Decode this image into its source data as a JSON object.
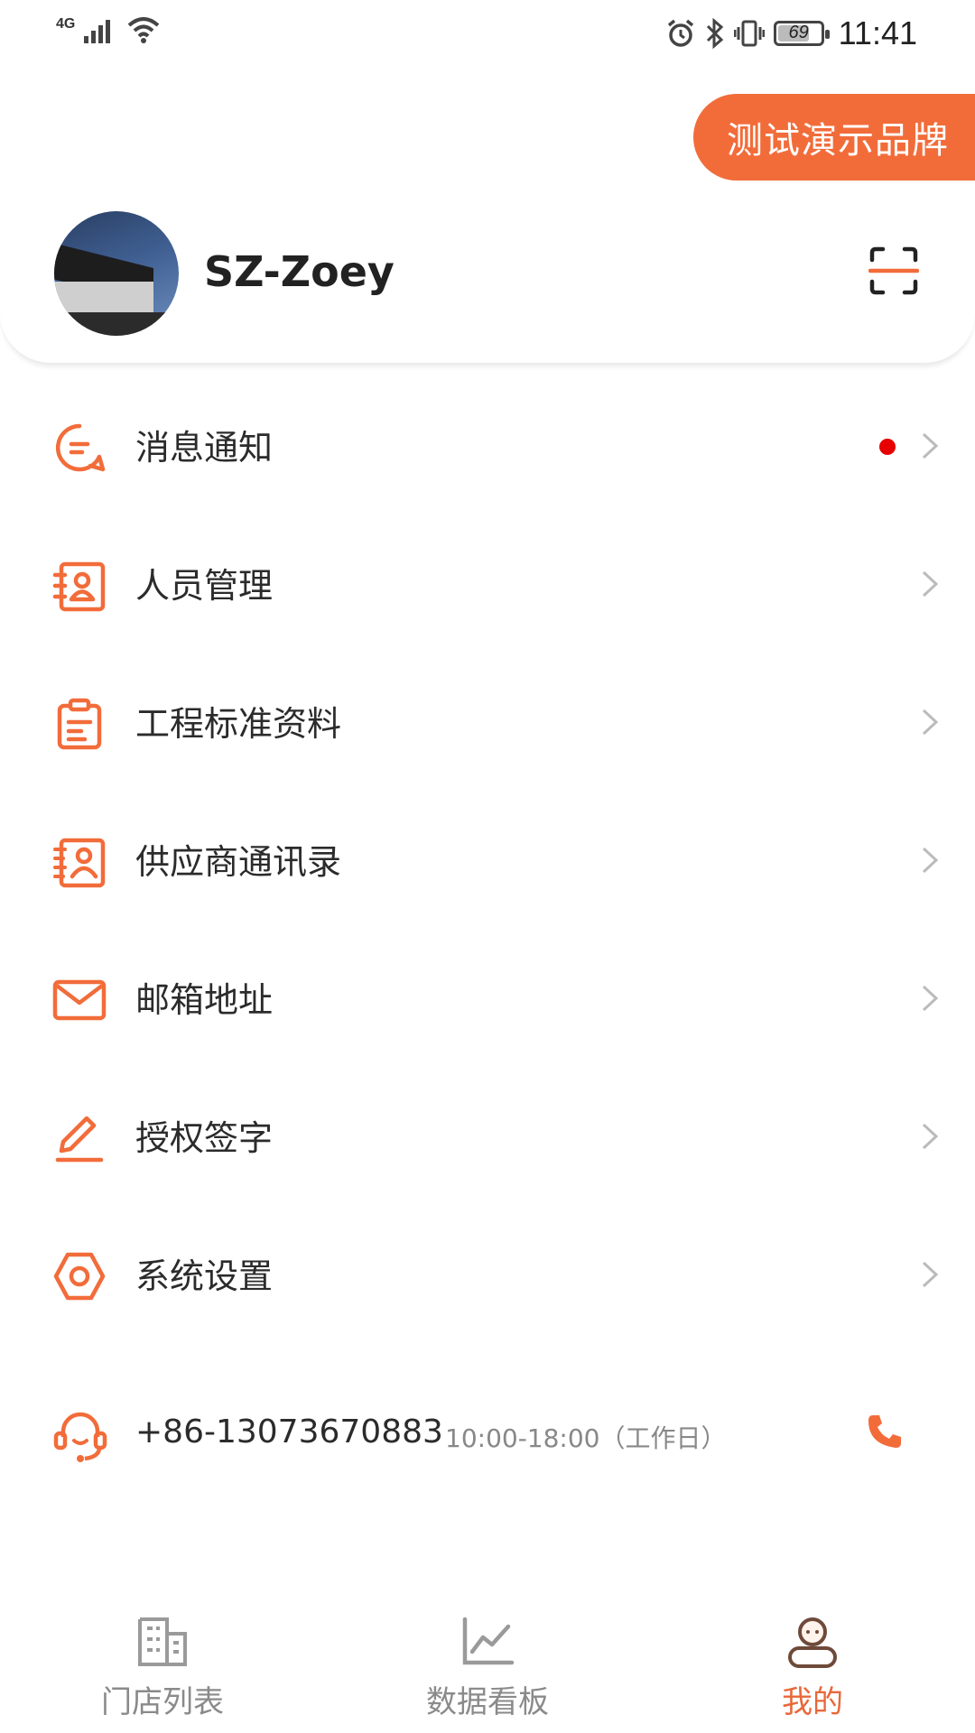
{
  "status_bar": {
    "network": "4G",
    "battery": "69",
    "time": "11:41"
  },
  "brand": {
    "label": "测试演示品牌"
  },
  "profile": {
    "username": "SZ-Zoey"
  },
  "menu": [
    {
      "label": "消息通知",
      "icon": "message-icon",
      "has_dot": true
    },
    {
      "label": "人员管理",
      "icon": "staff-card-icon",
      "has_dot": false
    },
    {
      "label": "工程标准资料",
      "icon": "clipboard-icon",
      "has_dot": false
    },
    {
      "label": "供应商通讯录",
      "icon": "contacts-book-icon",
      "has_dot": false
    },
    {
      "label": "邮箱地址",
      "icon": "mail-icon",
      "has_dot": false
    },
    {
      "label": "授权签字",
      "icon": "pen-icon",
      "has_dot": false
    },
    {
      "label": "系统设置",
      "icon": "settings-hexagon-icon",
      "has_dot": false
    }
  ],
  "support": {
    "phone": "+86-13073670883",
    "hours": "10:00-18:00（工作日）"
  },
  "tabs": [
    {
      "label": "门店列表",
      "icon": "store-building-icon",
      "active": false
    },
    {
      "label": "数据看板",
      "icon": "line-chart-icon",
      "active": false
    },
    {
      "label": "我的",
      "icon": "profile-icon",
      "active": true
    }
  ],
  "colors": {
    "accent": "#f26c3a",
    "notification_dot": "#e60000",
    "inactive_tab": "#8a8a8a"
  }
}
